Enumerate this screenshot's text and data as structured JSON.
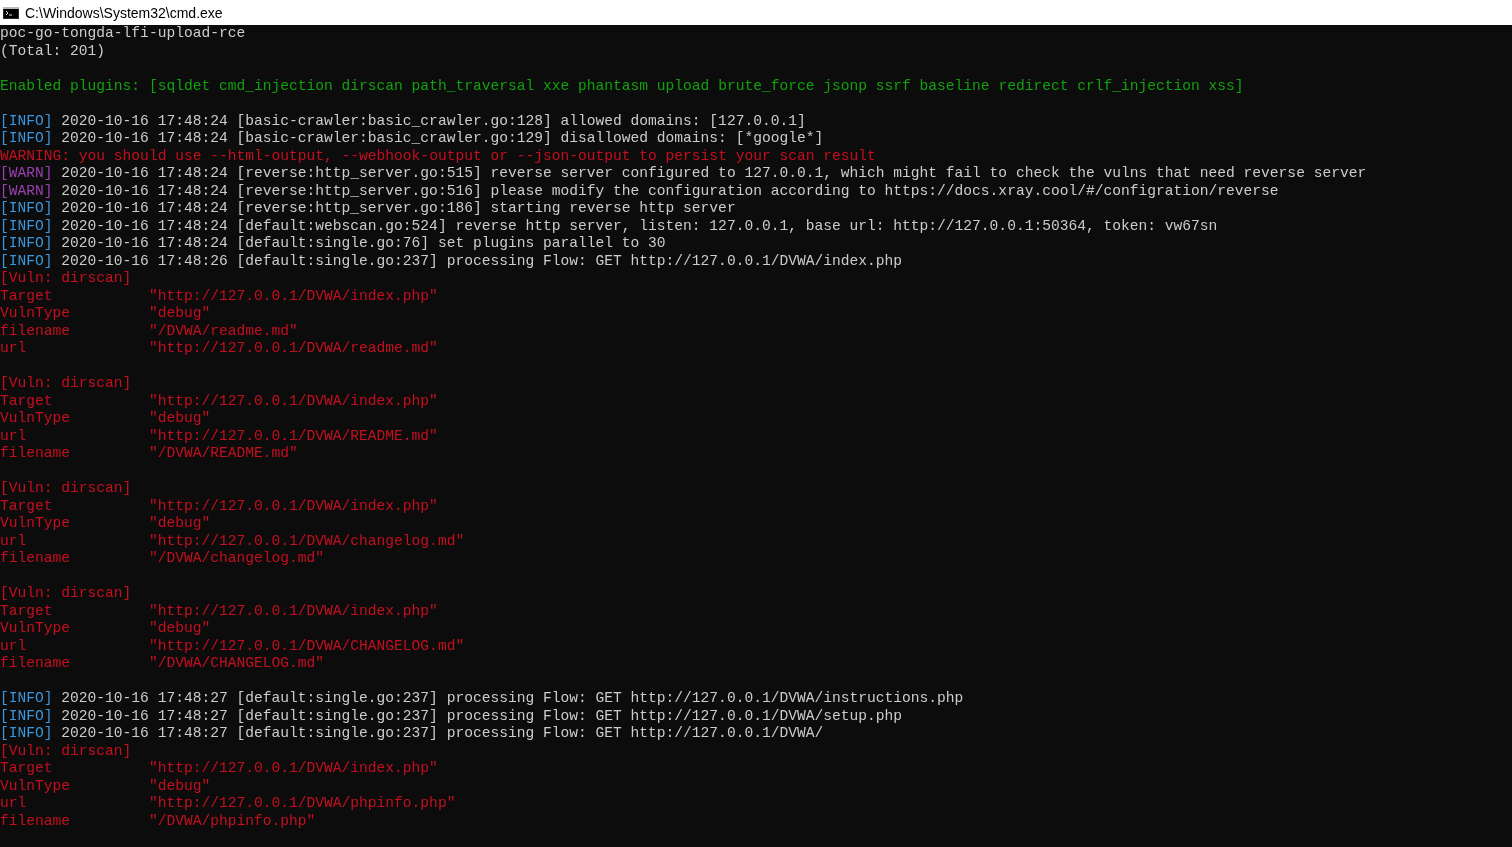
{
  "window": {
    "title": "C:\\Windows\\System32\\cmd.exe"
  },
  "lines": [
    {
      "kind": "plain",
      "text": "poc-go-tongda-lfi-upload-rce"
    },
    {
      "kind": "plain",
      "text": "(Total: 201)"
    },
    {
      "kind": "blank"
    },
    {
      "kind": "plugins",
      "text": "Enabled plugins: [sqldet cmd_injection dirscan path_traversal xxe phantasm upload brute_force jsonp ssrf baseline redirect crlf_injection xss]"
    },
    {
      "kind": "blank"
    },
    {
      "kind": "log",
      "tag": "[INFO]",
      "color": "#3a96dd",
      "text": "2020-10-16 17:48:24 [basic-crawler:basic_crawler.go:128] allowed domains: [127.0.0.1]"
    },
    {
      "kind": "log",
      "tag": "[INFO]",
      "color": "#3a96dd",
      "text": "2020-10-16 17:48:24 [basic-crawler:basic_crawler.go:129] disallowed domains: [*google*]"
    },
    {
      "kind": "warning",
      "text": "WARNING: you should use --html-output, --webhook-output or --json-output to persist your scan result"
    },
    {
      "kind": "log",
      "tag": "[WARN]",
      "color": "#9a3fb0",
      "text": "2020-10-16 17:48:24 [reverse:http_server.go:515] reverse server configured to 127.0.0.1, which might fail to check the vulns that need reverse server"
    },
    {
      "kind": "log",
      "tag": "[WARN]",
      "color": "#9a3fb0",
      "text": "2020-10-16 17:48:24 [reverse:http_server.go:516] please modify the configuration according to https://docs.xray.cool/#/configration/reverse"
    },
    {
      "kind": "log",
      "tag": "[INFO]",
      "color": "#3a96dd",
      "text": "2020-10-16 17:48:24 [reverse:http_server.go:186] starting reverse http server"
    },
    {
      "kind": "log",
      "tag": "[INFO]",
      "color": "#3a96dd",
      "text": "2020-10-16 17:48:24 [default:webscan.go:524] reverse http server, listen: 127.0.0.1, base url: http://127.0.0.1:50364, token: vw67sn"
    },
    {
      "kind": "log",
      "tag": "[INFO]",
      "color": "#3a96dd",
      "text": "2020-10-16 17:48:24 [default:single.go:76] set plugins parallel to 30"
    },
    {
      "kind": "log",
      "tag": "[INFO]",
      "color": "#3a96dd",
      "text": "2020-10-16 17:48:26 [default:single.go:237] processing Flow: GET http://127.0.0.1/DVWA/index.php"
    },
    {
      "kind": "vuln",
      "text": "[Vuln: dirscan]"
    },
    {
      "kind": "field",
      "key": "Target",
      "value": "\"http://127.0.0.1/DVWA/index.php\""
    },
    {
      "kind": "field",
      "key": "VulnType",
      "value": "\"debug\""
    },
    {
      "kind": "field",
      "key": "filename",
      "value": "\"/DVWA/readme.md\""
    },
    {
      "kind": "field",
      "key": "url",
      "value": "\"http://127.0.0.1/DVWA/readme.md\""
    },
    {
      "kind": "blank"
    },
    {
      "kind": "vuln",
      "text": "[Vuln: dirscan]"
    },
    {
      "kind": "field",
      "key": "Target",
      "value": "\"http://127.0.0.1/DVWA/index.php\""
    },
    {
      "kind": "field",
      "key": "VulnType",
      "value": "\"debug\""
    },
    {
      "kind": "field",
      "key": "url",
      "value": "\"http://127.0.0.1/DVWA/README.md\""
    },
    {
      "kind": "field",
      "key": "filename",
      "value": "\"/DVWA/README.md\""
    },
    {
      "kind": "blank"
    },
    {
      "kind": "vuln",
      "text": "[Vuln: dirscan]"
    },
    {
      "kind": "field",
      "key": "Target",
      "value": "\"http://127.0.0.1/DVWA/index.php\""
    },
    {
      "kind": "field",
      "key": "VulnType",
      "value": "\"debug\""
    },
    {
      "kind": "field",
      "key": "url",
      "value": "\"http://127.0.0.1/DVWA/changelog.md\""
    },
    {
      "kind": "field",
      "key": "filename",
      "value": "\"/DVWA/changelog.md\""
    },
    {
      "kind": "blank"
    },
    {
      "kind": "vuln",
      "text": "[Vuln: dirscan]"
    },
    {
      "kind": "field",
      "key": "Target",
      "value": "\"http://127.0.0.1/DVWA/index.php\""
    },
    {
      "kind": "field",
      "key": "VulnType",
      "value": "\"debug\""
    },
    {
      "kind": "field",
      "key": "url",
      "value": "\"http://127.0.0.1/DVWA/CHANGELOG.md\""
    },
    {
      "kind": "field",
      "key": "filename",
      "value": "\"/DVWA/CHANGELOG.md\""
    },
    {
      "kind": "blank"
    },
    {
      "kind": "log",
      "tag": "[INFO]",
      "color": "#3a96dd",
      "text": "2020-10-16 17:48:27 [default:single.go:237] processing Flow: GET http://127.0.0.1/DVWA/instructions.php"
    },
    {
      "kind": "log",
      "tag": "[INFO]",
      "color": "#3a96dd",
      "text": "2020-10-16 17:48:27 [default:single.go:237] processing Flow: GET http://127.0.0.1/DVWA/setup.php"
    },
    {
      "kind": "log",
      "tag": "[INFO]",
      "color": "#3a96dd",
      "text": "2020-10-16 17:48:27 [default:single.go:237] processing Flow: GET http://127.0.0.1/DVWA/"
    },
    {
      "kind": "vuln",
      "text": "[Vuln: dirscan]"
    },
    {
      "kind": "field",
      "key": "Target",
      "value": "\"http://127.0.0.1/DVWA/index.php\""
    },
    {
      "kind": "field",
      "key": "VulnType",
      "value": "\"debug\""
    },
    {
      "kind": "field",
      "key": "url",
      "value": "\"http://127.0.0.1/DVWA/phpinfo.php\""
    },
    {
      "kind": "field",
      "key": "filename",
      "value": "\"/DVWA/phpinfo.php\""
    }
  ]
}
